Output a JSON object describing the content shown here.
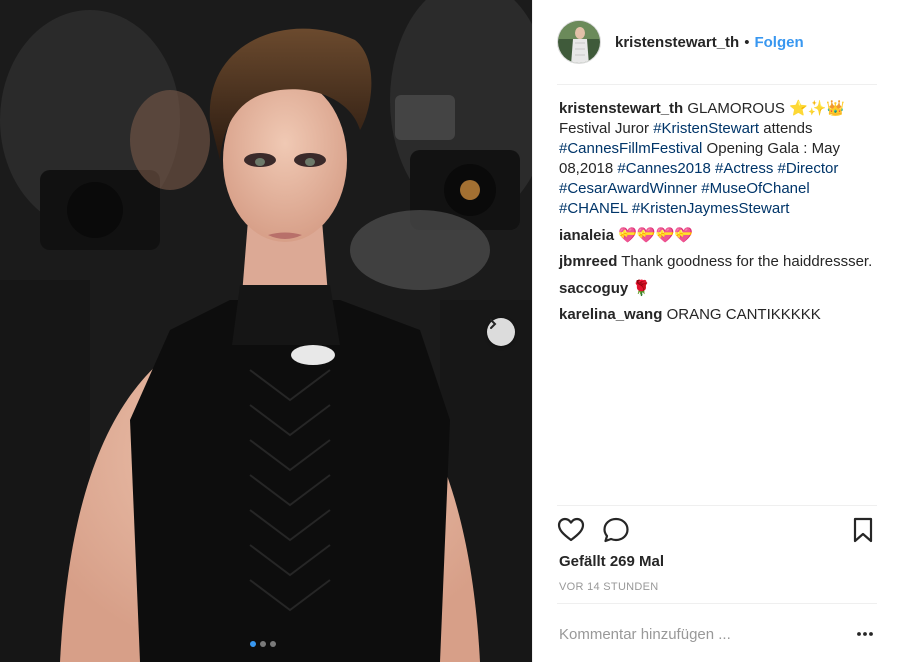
{
  "post": {
    "image_alt": "Kristen Stewart on the red carpet",
    "carousel": {
      "total_slides": 3,
      "active_slide": 1
    }
  },
  "header": {
    "username": "kristenstewart_th",
    "separator": "•",
    "follow_label": "Folgen",
    "avatar_icon": "profile-avatar-icon"
  },
  "caption": {
    "username": "kristenstewart_th",
    "segments": [
      {
        "text": "GLAMOROUS ",
        "kind": "text"
      },
      {
        "text": "⭐✨👑",
        "kind": "emoji"
      },
      {
        "text": " Festival Juror ",
        "kind": "text"
      },
      {
        "text": "#KristenStewart",
        "kind": "hashtag"
      },
      {
        "text": " attends ",
        "kind": "text"
      },
      {
        "text": "#CannesFillmFestival",
        "kind": "hashtag"
      },
      {
        "text": " Opening Gala : May 08,2018 ",
        "kind": "text"
      },
      {
        "text": "#Cannes2018",
        "kind": "hashtag"
      },
      {
        "text": " ",
        "kind": "text"
      },
      {
        "text": "#Actress",
        "kind": "hashtag"
      },
      {
        "text": " ",
        "kind": "text"
      },
      {
        "text": "#Director",
        "kind": "hashtag"
      },
      {
        "text": " ",
        "kind": "text"
      },
      {
        "text": "#CesarAwardWinner",
        "kind": "hashtag"
      },
      {
        "text": " ",
        "kind": "text"
      },
      {
        "text": "#MuseOfChanel",
        "kind": "hashtag"
      },
      {
        "text": " ",
        "kind": "text"
      },
      {
        "text": "#CHANEL",
        "kind": "hashtag"
      },
      {
        "text": " ",
        "kind": "text"
      },
      {
        "text": "#KristenJaymesStewart",
        "kind": "hashtag"
      }
    ]
  },
  "comments": [
    {
      "username": "ianaleia",
      "text": "💝💝💝💝"
    },
    {
      "username": "jbmreed",
      "text": "Thank goodness for the haiddressser."
    },
    {
      "username": "saccoguy",
      "text": "🌹"
    },
    {
      "username": "karelina_wang",
      "text": "ORANG CANTIKKKKK"
    }
  ],
  "actions": {
    "like_icon": "heart-icon",
    "comment_icon": "comment-bubble-icon",
    "save_icon": "bookmark-icon"
  },
  "likes_label": "Gefällt 269 Mal",
  "timestamp": "VOR 14 STUNDEN",
  "comment_box": {
    "placeholder": "Kommentar hinzufügen ...",
    "value": "",
    "more_icon": "more-options-icon"
  },
  "colors": {
    "link_blue": "#3897f0",
    "hashtag": "#003569",
    "text": "#262626",
    "muted": "#999999",
    "divider": "#efefef"
  }
}
